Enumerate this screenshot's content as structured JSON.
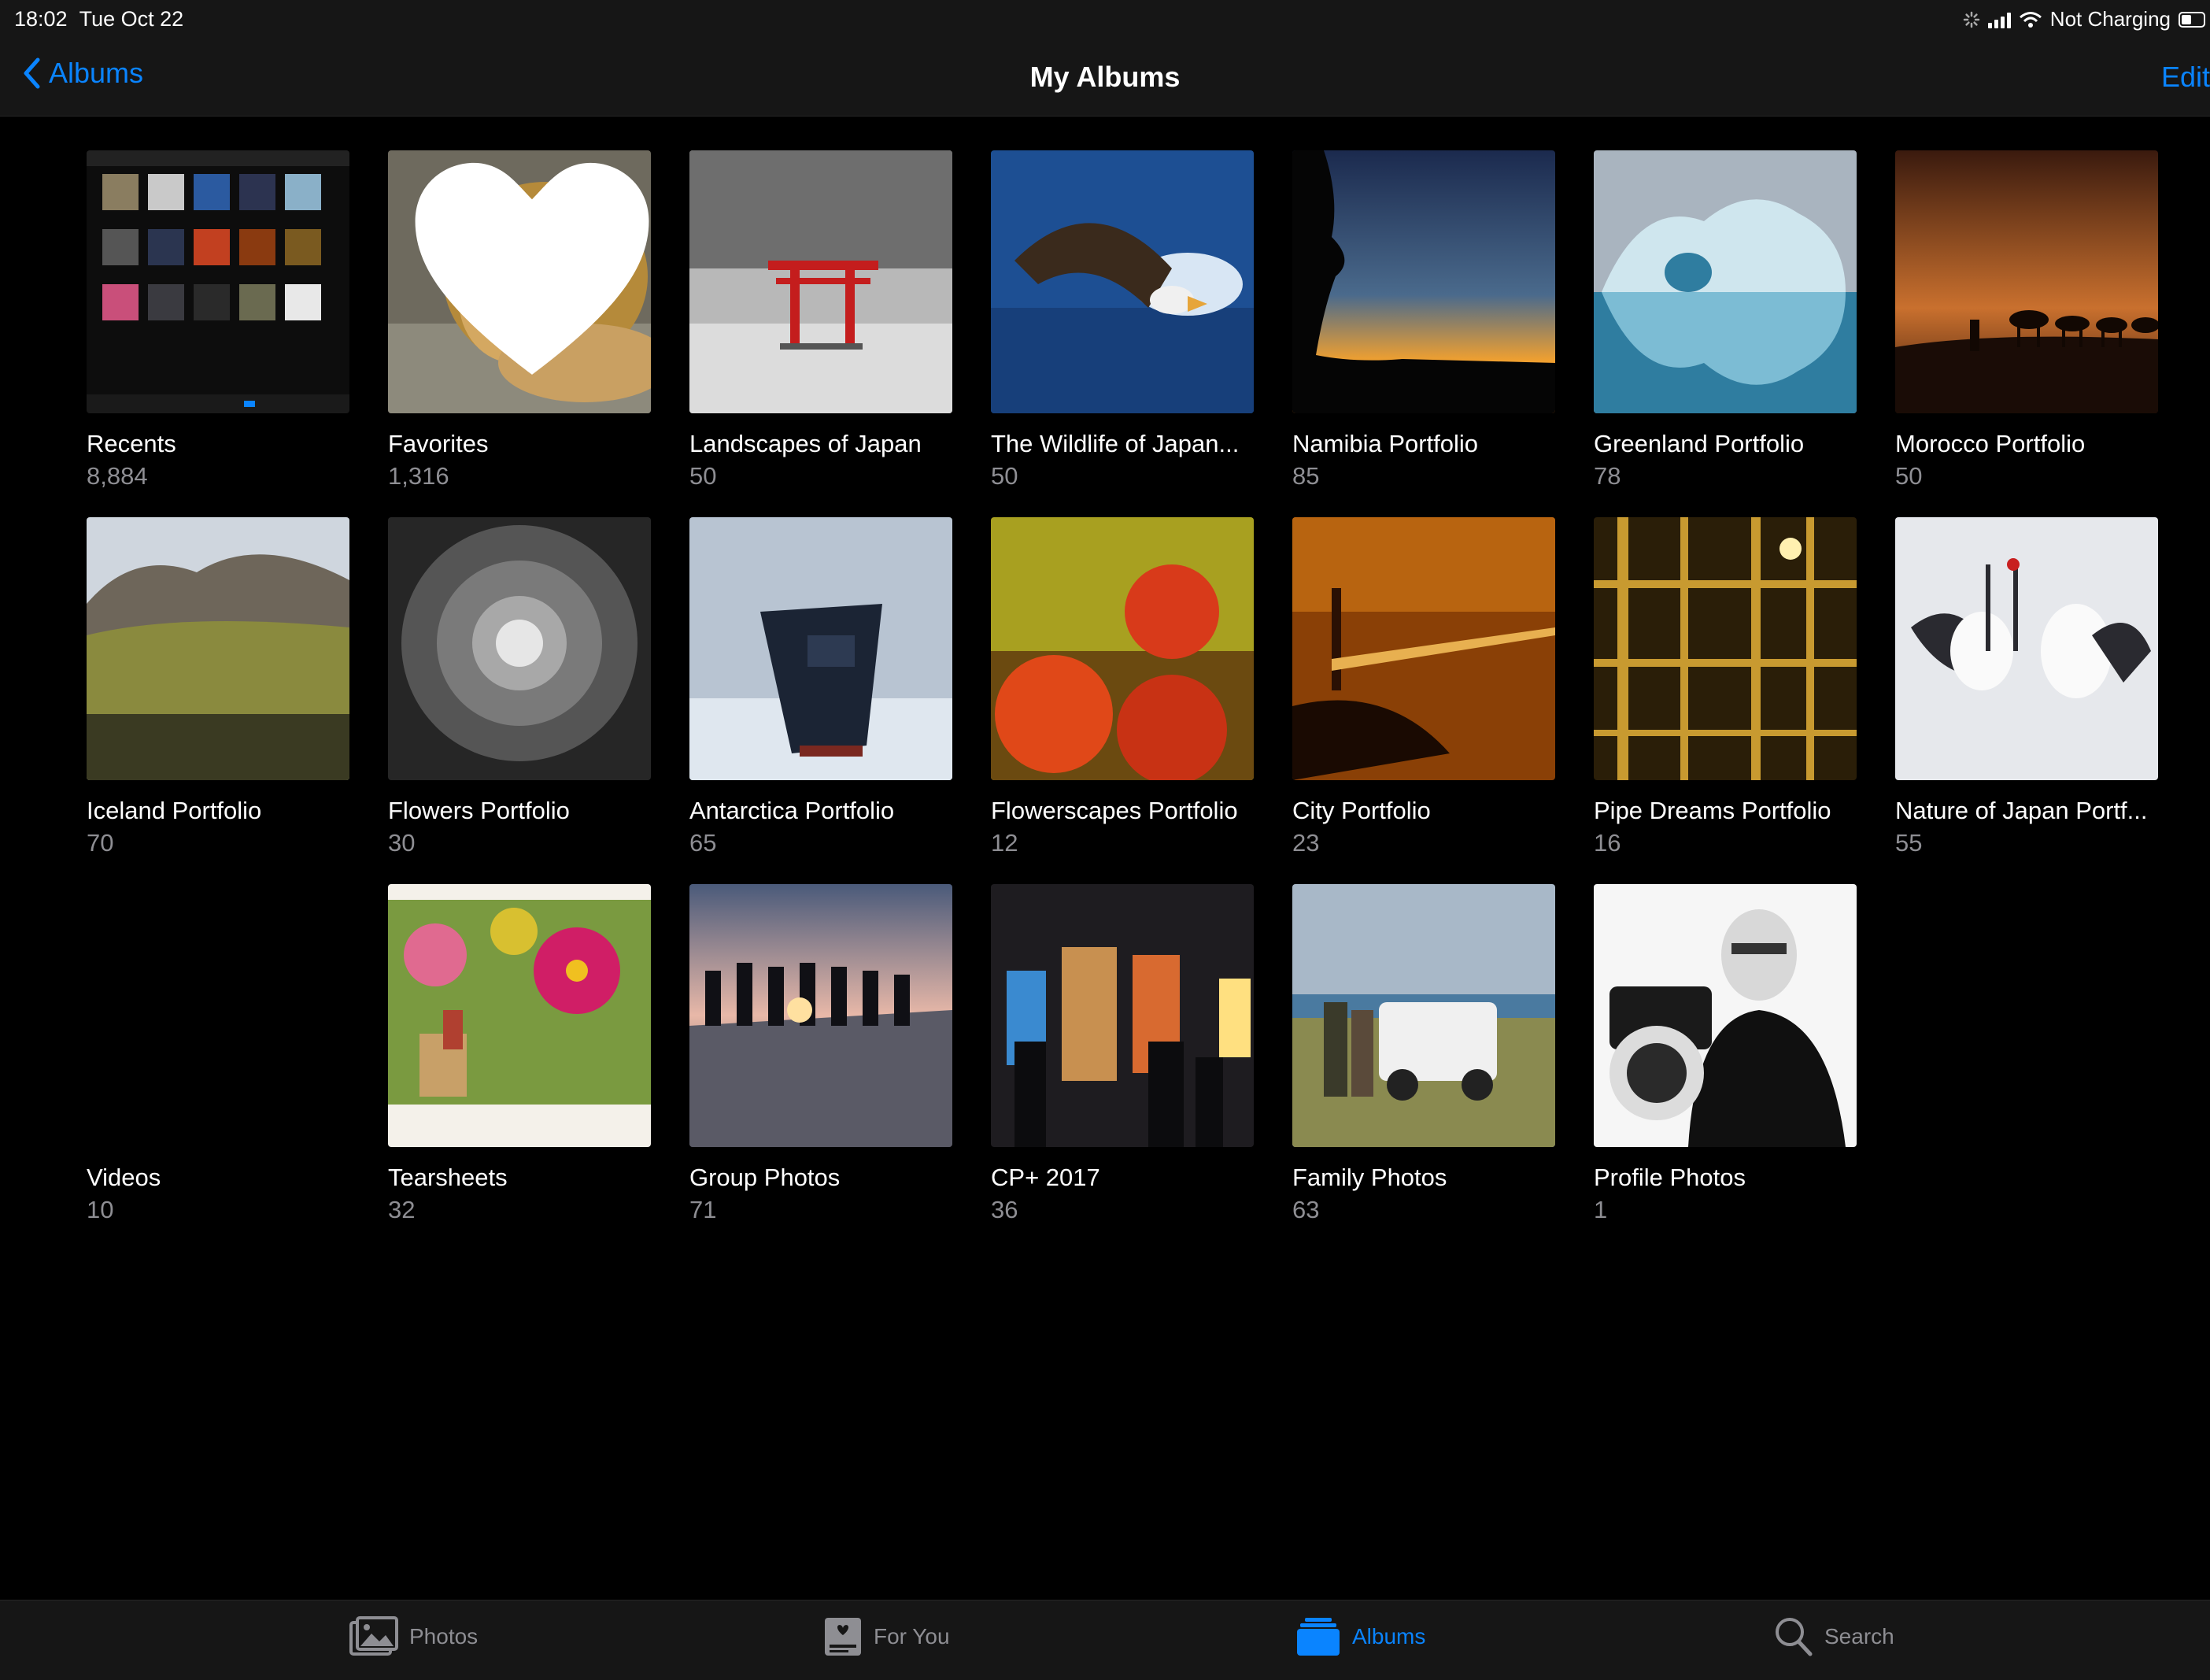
{
  "status_bar": {
    "time": "18:02",
    "date": "Tue Oct 22",
    "battery_text": "Not Charging",
    "icons": [
      "activity-icon",
      "signal-icon",
      "wifi-icon",
      "battery-icon"
    ]
  },
  "nav": {
    "back_label": "Albums",
    "title": "My Albums",
    "edit_label": "Edit",
    "back_icon": "chevron-left-icon"
  },
  "albums": [
    {
      "title": "Recents",
      "count": "8,884"
    },
    {
      "title": "Favorites",
      "count": "1,316"
    },
    {
      "title": "Landscapes of Japan",
      "count": "50"
    },
    {
      "title": "The Wildlife of Japan...",
      "count": "50"
    },
    {
      "title": "Namibia Portfolio",
      "count": "85"
    },
    {
      "title": "Greenland Portfolio",
      "count": "78"
    },
    {
      "title": "Morocco Portfolio",
      "count": "50"
    },
    {
      "title": "Iceland Portfolio",
      "count": "70"
    },
    {
      "title": "Flowers Portfolio",
      "count": "30"
    },
    {
      "title": "Antarctica Portfolio",
      "count": "65"
    },
    {
      "title": "Flowerscapes Portfolio",
      "count": "12"
    },
    {
      "title": "City Portfolio",
      "count": "23"
    },
    {
      "title": "Pipe Dreams Portfolio",
      "count": "16"
    },
    {
      "title": "Nature of Japan Portf...",
      "count": "55"
    },
    {
      "title": "Videos",
      "count": "10"
    },
    {
      "title": "Tearsheets",
      "count": "32"
    },
    {
      "title": "Group Photos",
      "count": "71"
    },
    {
      "title": "CP+ 2017",
      "count": "36"
    },
    {
      "title": "Family Photos",
      "count": "63"
    },
    {
      "title": "Profile Photos",
      "count": "1"
    }
  ],
  "tabs": [
    {
      "label": "Photos",
      "icon": "photos-icon",
      "active": false
    },
    {
      "label": "For You",
      "icon": "for-you-icon",
      "active": false
    },
    {
      "label": "Albums",
      "icon": "albums-icon",
      "active": true
    },
    {
      "label": "Search",
      "icon": "search-icon",
      "active": false
    }
  ],
  "colors": {
    "accent": "#0a84ff",
    "background": "#000000",
    "bar": "#161616",
    "secondary_text": "#8e8e93"
  }
}
